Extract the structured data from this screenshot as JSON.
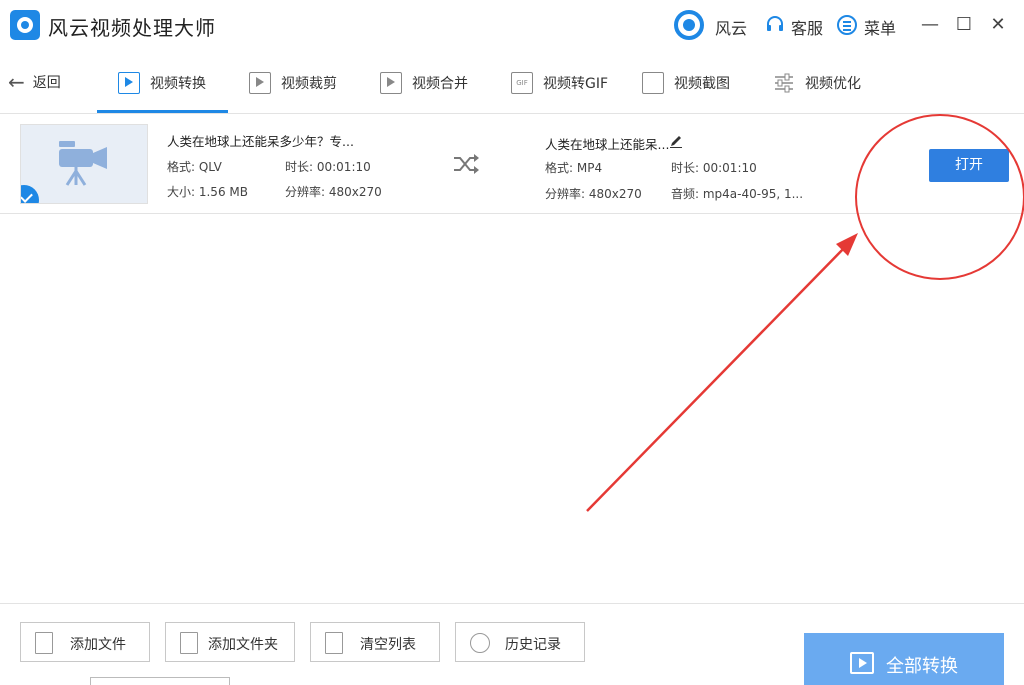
{
  "app": {
    "title": "风云视频处理大师"
  },
  "header": {
    "user_name": "风云",
    "support_label": "客服",
    "menu_label": "菜单",
    "minimize": "—",
    "maximize": "☐",
    "close": "✕"
  },
  "nav": {
    "back_label": "返回",
    "tabs": [
      {
        "label": "视频转换",
        "icon": "video-convert-icon",
        "active": true
      },
      {
        "label": "视频裁剪",
        "icon": "video-crop-icon"
      },
      {
        "label": "视频合并",
        "icon": "video-merge-icon"
      },
      {
        "label": "视频转GIF",
        "icon": "gif-icon"
      },
      {
        "label": "视频截图",
        "icon": "screenshot-icon"
      },
      {
        "label": "视频优化",
        "icon": "sliders-icon"
      }
    ]
  },
  "file": {
    "source": {
      "name": "人类在地球上还能呆多少年？专...",
      "format": "格式: QLV",
      "duration": "时长: 00:01:10",
      "size": "大小: 1.56 MB",
      "resolution": "分辨率: 480x270"
    },
    "output": {
      "name": "人类在地球上还能呆...",
      "format": "格式: MP4",
      "duration": "时长: 00:01:10",
      "resolution": "分辨率: 480x270",
      "audio": "音频: mp4a-40-95, 1..."
    },
    "open_button": "打开"
  },
  "bottom": {
    "add_file": "添加文件",
    "add_folder": "添加文件夹",
    "clear_list": "清空列表",
    "history": "历史记录",
    "convert_all": "全部转换"
  },
  "colors": {
    "accent": "#1e88e5",
    "annotation": "#e53935"
  }
}
